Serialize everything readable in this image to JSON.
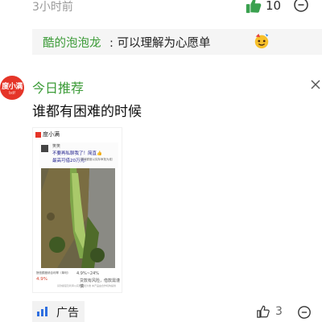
{
  "comment": {
    "time": "3小时前",
    "like_count": "10",
    "reply": {
      "user": "酷的泡泡龙",
      "text": ": 可以理解为心愿单"
    }
  },
  "ad": {
    "avatar_text": "度小满",
    "avatar_sub": "bdf",
    "title": "今日推荐",
    "headline": "谁都有困难的时候",
    "image": {
      "brand": "度小满",
      "name": "笑笑",
      "line1": "不要再私聊我了！简直👍",
      "line2": "最高可借20万元!",
      "line2_note": "（具体额度以实际审批为准）",
      "footer_left1": "授信额度综合利率（单利）",
      "footer_left2": "4.9%",
      "footer_right1": "4.9%~24%",
      "footer_right2": "贷款有风险，借款需谨慎",
      "disclaimer": "贷款额度及利率以实际审批为准 本产品由合作机构提供"
    },
    "tag_label": "广告",
    "like_count": "3"
  },
  "colors": {
    "accent_green": "#3b9b37",
    "brand_red": "#e53528"
  },
  "icons": {
    "like": "thumbs-up-icon",
    "comment": "comment-bubble-icon",
    "close": "close-icon",
    "ad_tag": "bar-chart-icon",
    "emoji": "party-face-emoji"
  }
}
